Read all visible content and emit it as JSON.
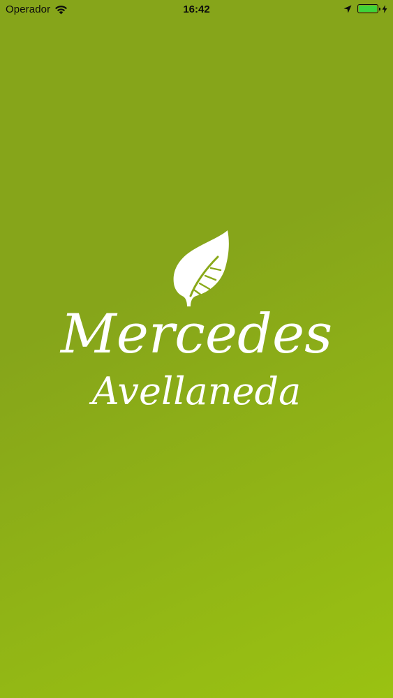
{
  "status_bar": {
    "carrier": "Operador",
    "time": "16:42",
    "battery_level": 1.0,
    "battery_color": "#3ed43a",
    "icons": [
      "wifi-icon",
      "location-arrow-icon",
      "battery-icon",
      "charging-bolt-icon"
    ]
  },
  "splash": {
    "brand_line1": "Mercedes",
    "brand_line2": "Avellaneda",
    "logo_icon": "leaf-icon",
    "background_colors": [
      "#86a51a",
      "#9ac212"
    ]
  }
}
